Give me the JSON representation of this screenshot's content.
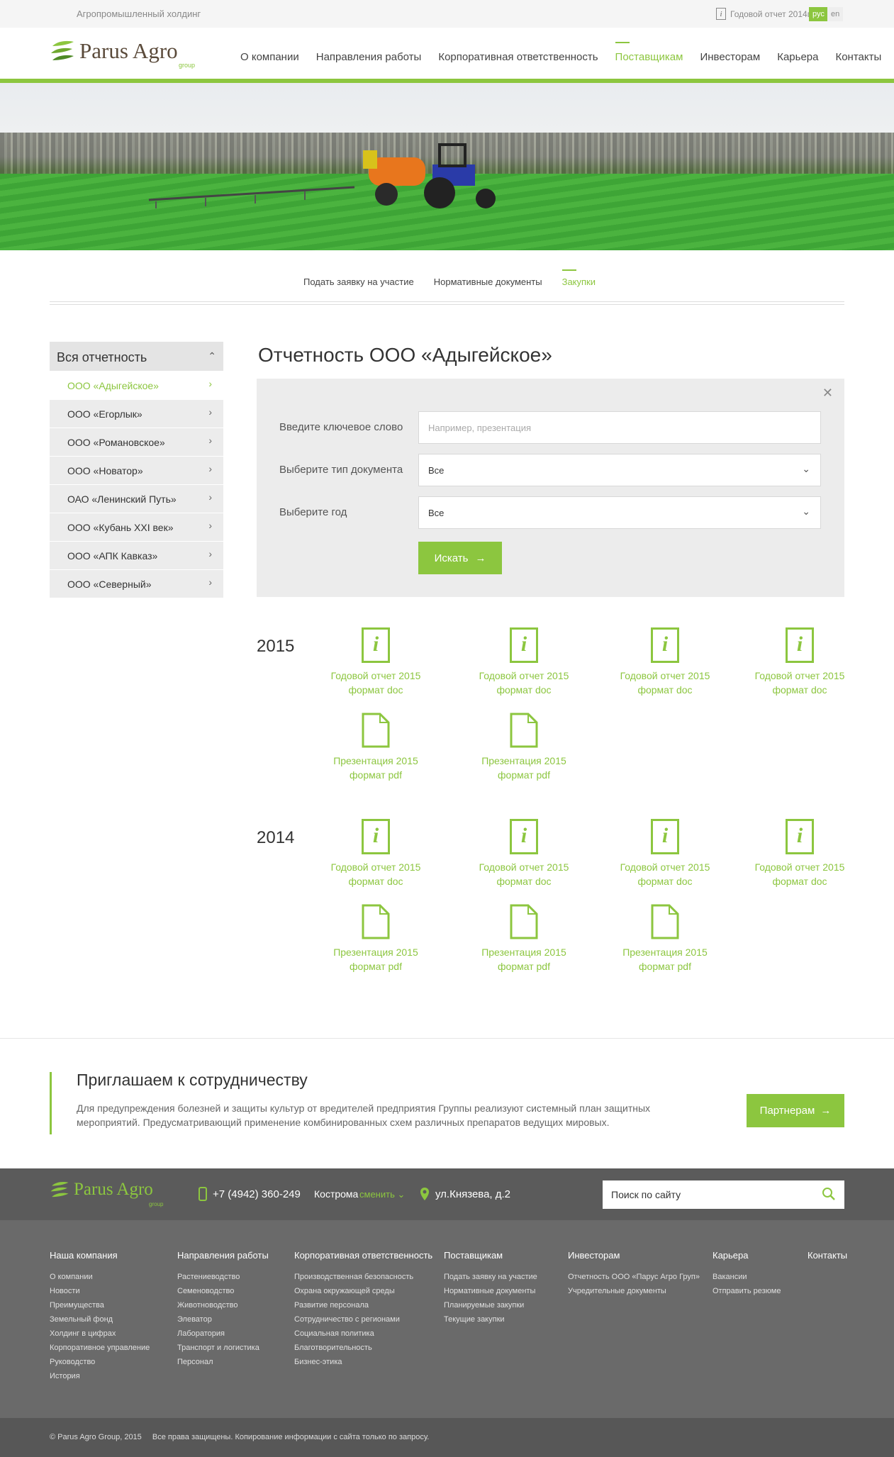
{
  "topbar": {
    "tagline": "Агропромышленный холдинг",
    "report_label": "Годовой отчет 2014г",
    "lang_ru": "рус",
    "lang_en": "en"
  },
  "header": {
    "logo_name": "Parus Agro",
    "logo_group": "group",
    "nav": [
      {
        "label": "О компании"
      },
      {
        "label": "Направления работы"
      },
      {
        "label": "Корпоративная ответственность"
      },
      {
        "label": "Поставщикам",
        "active": true
      },
      {
        "label": "Инвесторам"
      },
      {
        "label": "Карьера"
      },
      {
        "label": "Контакты"
      }
    ]
  },
  "subnav": {
    "items": [
      "Подать заявку на участие",
      "Нормативные документы",
      "Закупки"
    ],
    "active_index": 2
  },
  "sidebar": {
    "title": "Вся отчетность",
    "items": [
      "ООО «Адыгейское»",
      "ООО «Егорлык»",
      "ООО «Романовское»",
      "ООО «Новатор»",
      "ОАО «Ленинский Путь»",
      "ООО «Кубань XXI век»",
      "ООО «АПК Кавказ»",
      "ООО «Северный»"
    ],
    "active_index": 0
  },
  "main": {
    "title": "Отчетность ООО «Адыгейское»",
    "filter": {
      "keyword_label": "Введите ключевое слово",
      "keyword_placeholder": "Например, презентация",
      "type_label": "Выберите тип документа",
      "type_value": "Все",
      "year_label": "Выберите год",
      "year_value": "Все",
      "search_button": "Искать"
    },
    "years": [
      {
        "year": "2015",
        "docs": [
          {
            "kind": "info",
            "title": "Годовой отчет 2015",
            "format": "формат doc"
          },
          {
            "kind": "info",
            "title": "Годовой отчет 2015",
            "format": "формат doc"
          },
          {
            "kind": "info",
            "title": "Годовой отчет 2015",
            "format": "формат doc"
          },
          {
            "kind": "info",
            "title": "Годовой отчет 2015",
            "format": "формат doc"
          },
          {
            "kind": "page",
            "title": "Презентация 2015",
            "format": "формат pdf"
          },
          {
            "kind": "page",
            "title": "Презентация 2015",
            "format": "формат pdf"
          }
        ]
      },
      {
        "year": "2014",
        "docs": [
          {
            "kind": "info",
            "title": "Годовой отчет 2015",
            "format": "формат doc"
          },
          {
            "kind": "info",
            "title": "Годовой отчет 2015",
            "format": "формат doc"
          },
          {
            "kind": "info",
            "title": "Годовой отчет 2015",
            "format": "формат doc"
          },
          {
            "kind": "info",
            "title": "Годовой отчет 2015",
            "format": "формат doc"
          },
          {
            "kind": "page",
            "title": "Презентация 2015",
            "format": "формат pdf"
          },
          {
            "kind": "page",
            "title": "Презентация 2015",
            "format": "формат pdf"
          },
          {
            "kind": "page",
            "title": "Презентация 2015",
            "format": "формат pdf"
          }
        ]
      }
    ]
  },
  "invite": {
    "title": "Приглашаем к сотрудничеству",
    "text": "Для предупреждения болезней и защиты культур от вредителей предприятия Группы реализуют системный план защитных мероприятий. Предусматривающий применение комбинированных схем различных препаратов ведущих мировых.",
    "button": "Партнерам"
  },
  "footer": {
    "logo_name": "Parus Agro",
    "logo_group": "group",
    "phone": "+7 (4942) 360-249",
    "city": "Кострома",
    "change": "сменить",
    "address": "ул.Князева, д.2",
    "search_placeholder": "Поиск по сайту",
    "columns": [
      {
        "title": "Наша компания",
        "links": [
          "О компании",
          "Новости",
          "Преимущества",
          "Земельный фонд",
          "Холдинг в цифрах",
          "Корпоративное управление",
          "Руководство",
          "История"
        ]
      },
      {
        "title": "Направления работы",
        "links": [
          "Растениеводство",
          "Семеноводство",
          "Животноводство",
          "Элеватор",
          "Лаборатория",
          "Транспорт и логистика",
          "Персонал"
        ]
      },
      {
        "title": "Корпоративная ответственность",
        "links": [
          "Производственная безопасность",
          "Охрана окружающей среды",
          "Развитие персонала",
          "Сотрудничество с регионами",
          "Социальная политика",
          "Благотворительность",
          "Бизнес-этика"
        ]
      },
      {
        "title": "Поставщикам",
        "links": [
          "Подать заявку на участие",
          "Нормативные документы",
          "Планируемые закупки",
          "Текущие закупки"
        ]
      },
      {
        "title": "Инвесторам",
        "links": [
          "Отчетность ООО «Парус Агро Груп»",
          "Учредительные документы"
        ]
      },
      {
        "title": "Карьера",
        "links": [
          "Вакансии",
          "Отправить резюме"
        ]
      },
      {
        "title": "Контакты",
        "links": []
      }
    ],
    "copyright": "© Parus Agro Group, 2015",
    "rights": "Все права защищены. Копирование информации с сайта  только по запросу.",
    "brand_color": "#8cc63f"
  }
}
